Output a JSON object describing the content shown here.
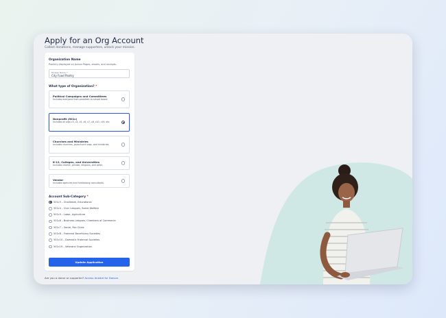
{
  "page": {
    "title": "Apply for an Org Account",
    "subtitle": "Collect donations, manage supporters, unlock your mission."
  },
  "org_name": {
    "section_label": "Organization Name",
    "help": "Publicly displayed on Action Pages, emails, and receipts.",
    "field_label": "Display Name",
    "required_mark": "*",
    "value": "City Food Pantry"
  },
  "org_type": {
    "question": "What type of Organization?",
    "required_mark": "*",
    "selected_index": 1,
    "options": [
      {
        "title": "Political Campaigns and Committees",
        "desc": "Includes everyone from president to school board."
      },
      {
        "title": "Nonprofit (501c)",
        "desc": "Includes all orgs c3, c4, c5, c6, c7, c8, c10, c19, etc."
      },
      {
        "title": "Churches and Ministries",
        "desc": "Includes churches, parachurch orgs, and ministries."
      },
      {
        "title": "K-12, Colleges, and Universities",
        "desc": "Includes charter, private, religious, and other."
      },
      {
        "title": "Vendor",
        "desc": "Includes agencies and fundraising consultants."
      }
    ]
  },
  "sub_category": {
    "label": "Account Sub-Category",
    "required_mark": "*",
    "selected_index": 0,
    "options": [
      "501c3 – Charitable, Educational",
      "501c4 – Civic Leagues, Social Welfare",
      "501c5 – Labor, Agriculture",
      "501c6 – Business Leagues, Chambers of Commerce",
      "501c7 – Social, Rec Clubs",
      "501c8 – Fraternal Beneficiary Societies",
      "501c10 – Domestic Fraternal Societies",
      "501c19 – Veterans Organization"
    ]
  },
  "actions": {
    "update_label": "Update Application"
  },
  "footer": {
    "donor_text": "Are you a donor or supporter?",
    "donor_link": "Access Anedot for Donors"
  },
  "colors": {
    "accent": "#2563eb",
    "hero_shape": "#cfe8e6",
    "window_bg": "#eef0f3"
  },
  "icons": {
    "hero": "woman-with-laptop-illustration"
  }
}
